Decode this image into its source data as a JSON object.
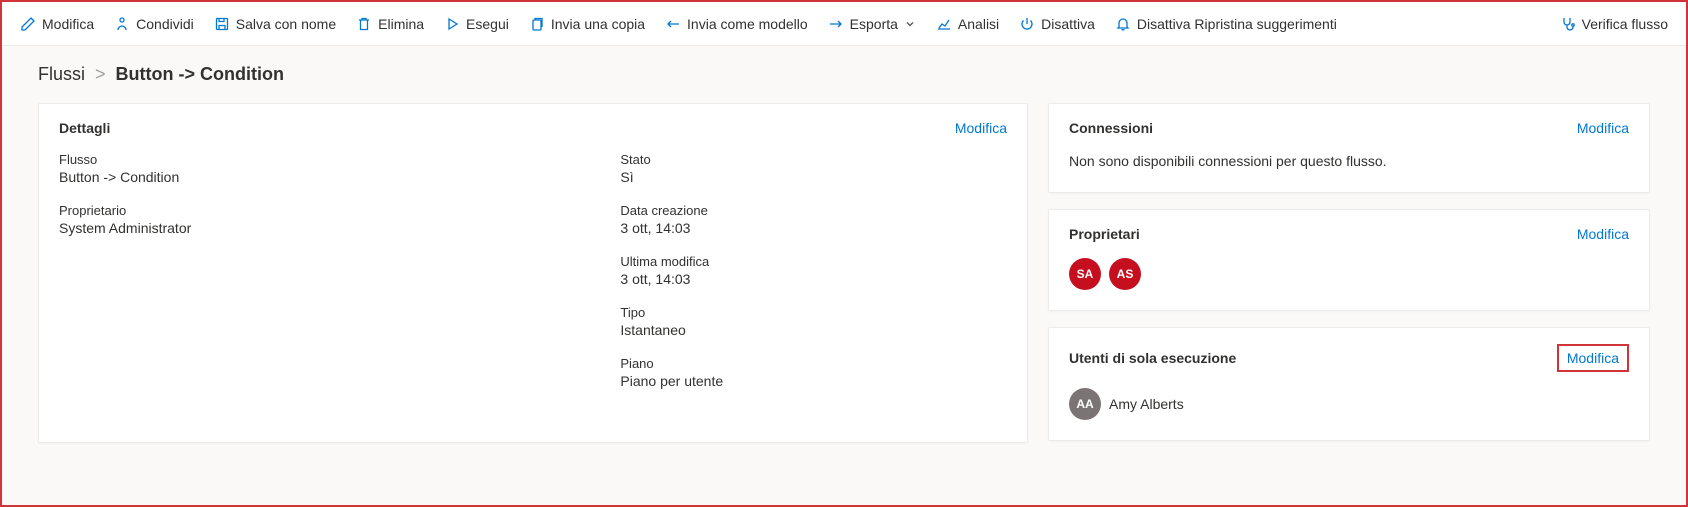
{
  "toolbar": {
    "edit": "Modifica",
    "share": "Condividi",
    "saveAs": "Salva con nome",
    "delete": "Elimina",
    "run": "Esegui",
    "sendCopy": "Invia una copia",
    "sendTemplate": "Invia come modello",
    "export": "Esporta",
    "analysis": "Analisi",
    "disable": "Disattiva",
    "toggleSuggestions": "Disattiva Ripristina suggerimenti",
    "verify": "Verifica flusso"
  },
  "breadcrumb": {
    "root": "Flussi",
    "current": "Button -> Condition"
  },
  "details": {
    "title": "Dettagli",
    "editLink": "Modifica",
    "flowLabel": "Flusso",
    "flowValue": "Button -> Condition",
    "ownerLabel": "Proprietario",
    "ownerValue": "System Administrator",
    "statusLabel": "Stato",
    "statusValue": "Sì",
    "createdLabel": "Data creazione",
    "createdValue": "3 ott, 14:03",
    "modifiedLabel": "Ultima modifica",
    "modifiedValue": "3 ott, 14:03",
    "typeLabel": "Tipo",
    "typeValue": "Istantaneo",
    "planLabel": "Piano",
    "planValue": "Piano per utente"
  },
  "connections": {
    "title": "Connessioni",
    "editLink": "Modifica",
    "empty": "Non sono disponibili connessioni per questo flusso."
  },
  "owners": {
    "title": "Proprietari",
    "editLink": "Modifica",
    "items": [
      {
        "initials": "SA"
      },
      {
        "initials": "AS"
      }
    ]
  },
  "runOnly": {
    "title": "Utenti di sola esecuzione",
    "editLink": "Modifica",
    "user": {
      "initials": "AA",
      "name": "Amy Alberts"
    }
  }
}
